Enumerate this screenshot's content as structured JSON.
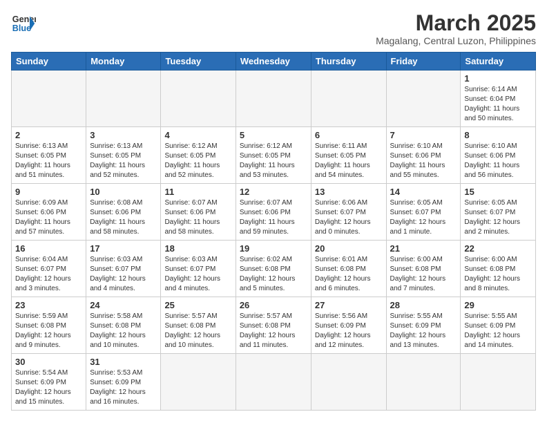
{
  "header": {
    "logo_general": "General",
    "logo_blue": "Blue",
    "month_title": "March 2025",
    "subtitle": "Magalang, Central Luzon, Philippines"
  },
  "weekdays": [
    "Sunday",
    "Monday",
    "Tuesday",
    "Wednesday",
    "Thursday",
    "Friday",
    "Saturday"
  ],
  "weeks": [
    [
      {
        "day": "",
        "info": ""
      },
      {
        "day": "",
        "info": ""
      },
      {
        "day": "",
        "info": ""
      },
      {
        "day": "",
        "info": ""
      },
      {
        "day": "",
        "info": ""
      },
      {
        "day": "",
        "info": ""
      },
      {
        "day": "1",
        "info": "Sunrise: 6:14 AM\nSunset: 6:04 PM\nDaylight: 11 hours and 50 minutes."
      }
    ],
    [
      {
        "day": "2",
        "info": "Sunrise: 6:13 AM\nSunset: 6:05 PM\nDaylight: 11 hours and 51 minutes."
      },
      {
        "day": "3",
        "info": "Sunrise: 6:13 AM\nSunset: 6:05 PM\nDaylight: 11 hours and 52 minutes."
      },
      {
        "day": "4",
        "info": "Sunrise: 6:12 AM\nSunset: 6:05 PM\nDaylight: 11 hours and 52 minutes."
      },
      {
        "day": "5",
        "info": "Sunrise: 6:12 AM\nSunset: 6:05 PM\nDaylight: 11 hours and 53 minutes."
      },
      {
        "day": "6",
        "info": "Sunrise: 6:11 AM\nSunset: 6:05 PM\nDaylight: 11 hours and 54 minutes."
      },
      {
        "day": "7",
        "info": "Sunrise: 6:10 AM\nSunset: 6:06 PM\nDaylight: 11 hours and 55 minutes."
      },
      {
        "day": "8",
        "info": "Sunrise: 6:10 AM\nSunset: 6:06 PM\nDaylight: 11 hours and 56 minutes."
      }
    ],
    [
      {
        "day": "9",
        "info": "Sunrise: 6:09 AM\nSunset: 6:06 PM\nDaylight: 11 hours and 57 minutes."
      },
      {
        "day": "10",
        "info": "Sunrise: 6:08 AM\nSunset: 6:06 PM\nDaylight: 11 hours and 58 minutes."
      },
      {
        "day": "11",
        "info": "Sunrise: 6:07 AM\nSunset: 6:06 PM\nDaylight: 11 hours and 58 minutes."
      },
      {
        "day": "12",
        "info": "Sunrise: 6:07 AM\nSunset: 6:06 PM\nDaylight: 11 hours and 59 minutes."
      },
      {
        "day": "13",
        "info": "Sunrise: 6:06 AM\nSunset: 6:07 PM\nDaylight: 12 hours and 0 minutes."
      },
      {
        "day": "14",
        "info": "Sunrise: 6:05 AM\nSunset: 6:07 PM\nDaylight: 12 hours and 1 minute."
      },
      {
        "day": "15",
        "info": "Sunrise: 6:05 AM\nSunset: 6:07 PM\nDaylight: 12 hours and 2 minutes."
      }
    ],
    [
      {
        "day": "16",
        "info": "Sunrise: 6:04 AM\nSunset: 6:07 PM\nDaylight: 12 hours and 3 minutes."
      },
      {
        "day": "17",
        "info": "Sunrise: 6:03 AM\nSunset: 6:07 PM\nDaylight: 12 hours and 4 minutes."
      },
      {
        "day": "18",
        "info": "Sunrise: 6:03 AM\nSunset: 6:07 PM\nDaylight: 12 hours and 4 minutes."
      },
      {
        "day": "19",
        "info": "Sunrise: 6:02 AM\nSunset: 6:08 PM\nDaylight: 12 hours and 5 minutes."
      },
      {
        "day": "20",
        "info": "Sunrise: 6:01 AM\nSunset: 6:08 PM\nDaylight: 12 hours and 6 minutes."
      },
      {
        "day": "21",
        "info": "Sunrise: 6:00 AM\nSunset: 6:08 PM\nDaylight: 12 hours and 7 minutes."
      },
      {
        "day": "22",
        "info": "Sunrise: 6:00 AM\nSunset: 6:08 PM\nDaylight: 12 hours and 8 minutes."
      }
    ],
    [
      {
        "day": "23",
        "info": "Sunrise: 5:59 AM\nSunset: 6:08 PM\nDaylight: 12 hours and 9 minutes."
      },
      {
        "day": "24",
        "info": "Sunrise: 5:58 AM\nSunset: 6:08 PM\nDaylight: 12 hours and 10 minutes."
      },
      {
        "day": "25",
        "info": "Sunrise: 5:57 AM\nSunset: 6:08 PM\nDaylight: 12 hours and 10 minutes."
      },
      {
        "day": "26",
        "info": "Sunrise: 5:57 AM\nSunset: 6:08 PM\nDaylight: 12 hours and 11 minutes."
      },
      {
        "day": "27",
        "info": "Sunrise: 5:56 AM\nSunset: 6:09 PM\nDaylight: 12 hours and 12 minutes."
      },
      {
        "day": "28",
        "info": "Sunrise: 5:55 AM\nSunset: 6:09 PM\nDaylight: 12 hours and 13 minutes."
      },
      {
        "day": "29",
        "info": "Sunrise: 5:55 AM\nSunset: 6:09 PM\nDaylight: 12 hours and 14 minutes."
      }
    ],
    [
      {
        "day": "30",
        "info": "Sunrise: 5:54 AM\nSunset: 6:09 PM\nDaylight: 12 hours and 15 minutes."
      },
      {
        "day": "31",
        "info": "Sunrise: 5:53 AM\nSunset: 6:09 PM\nDaylight: 12 hours and 16 minutes."
      },
      {
        "day": "",
        "info": ""
      },
      {
        "day": "",
        "info": ""
      },
      {
        "day": "",
        "info": ""
      },
      {
        "day": "",
        "info": ""
      },
      {
        "day": "",
        "info": ""
      }
    ]
  ]
}
